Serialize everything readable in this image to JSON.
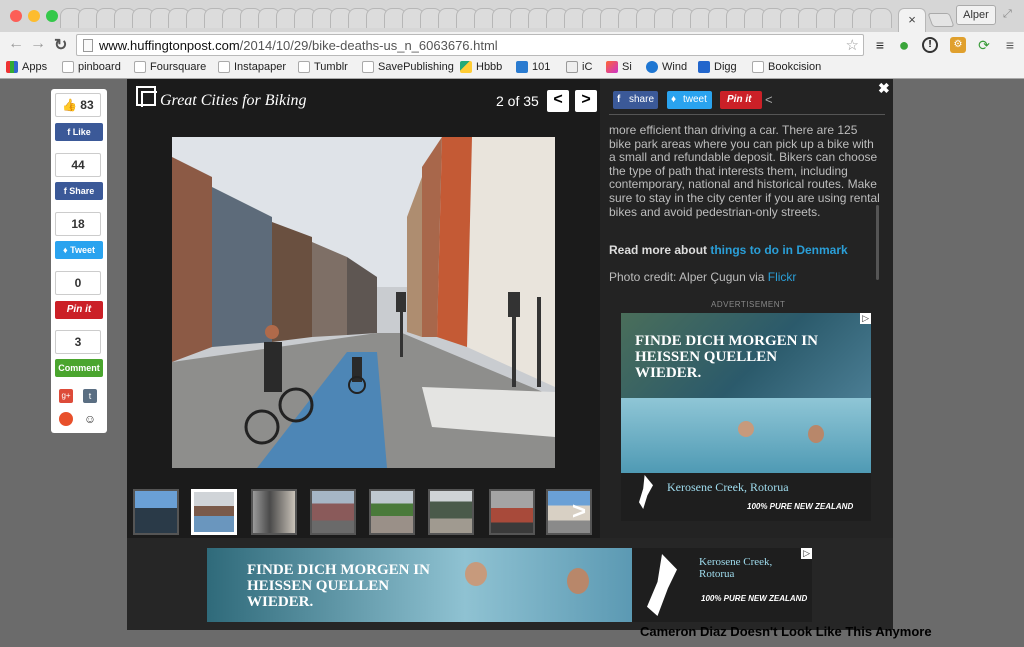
{
  "browser": {
    "active_tab_close": "×",
    "profile_name": "Alper",
    "url_domain": "www.huffingtonpost.com",
    "url_path": "/2014/10/29/bike-deaths-us_n_6063676.html"
  },
  "bookmarks": [
    {
      "label": "Apps"
    },
    {
      "label": "pinboard"
    },
    {
      "label": "Foursquare"
    },
    {
      "label": "Instapaper"
    },
    {
      "label": "Tumblr"
    },
    {
      "label": "SavePublishing"
    },
    {
      "label": "Hbbb"
    },
    {
      "label": "101"
    },
    {
      "label": "iC"
    },
    {
      "label": "Si"
    },
    {
      "label": "Wind"
    },
    {
      "label": "Digg"
    },
    {
      "label": "Bookcision"
    }
  ],
  "share_bar": {
    "like_count": "83",
    "like_label": "Like",
    "share_count": "44",
    "share_label": "Share",
    "tweet_count": "18",
    "tweet_label": "Tweet",
    "pin_count": "0",
    "pin_label": "Pin it",
    "comment_count": "3",
    "comment_label": "Comment"
  },
  "slideshow": {
    "title": "Great Cities for Biking",
    "counter": "2 of 35",
    "prev": "<",
    "next": ">",
    "thumb_next": ">"
  },
  "social": {
    "facebook": "share",
    "twitter": "tweet",
    "pinterest": "Pin it"
  },
  "article": {
    "description": "more efficient than driving a car. There are 125 bike park areas where you can pick up a bike with a small and refundable deposit. Bikers can choose the type of path that interests them, including contemporary, national and historical routes. Make sure to stay in the city center if you are using rental bikes and avoid pedestrian-only streets.",
    "read_more_prefix": "Read more about ",
    "read_more_link": "things to do in Denmark",
    "credit_prefix": "Photo credit: Alper Çugun via ",
    "credit_link": "Flickr"
  },
  "ads": {
    "label": "ADVERTISEMENT",
    "ad1_headline": "FINDE DICH MORGEN IN HEIßEN QUELLEN WIEDER.",
    "ad1_place": "Kerosene Creek, Rotorua",
    "ad1_tagline": "100% PURE NEW ZEALAND",
    "ad2_headline": "FINDE DICH MORGEN IN HEISSEN QUELLEN WIEDER.",
    "ad2_place": "Kerosene Creek, Rotorua",
    "ad2_tagline": "100% PURE NEW ZEALAND"
  },
  "below_content": "Cameron Diaz Doesn't Look Like This Anymore"
}
